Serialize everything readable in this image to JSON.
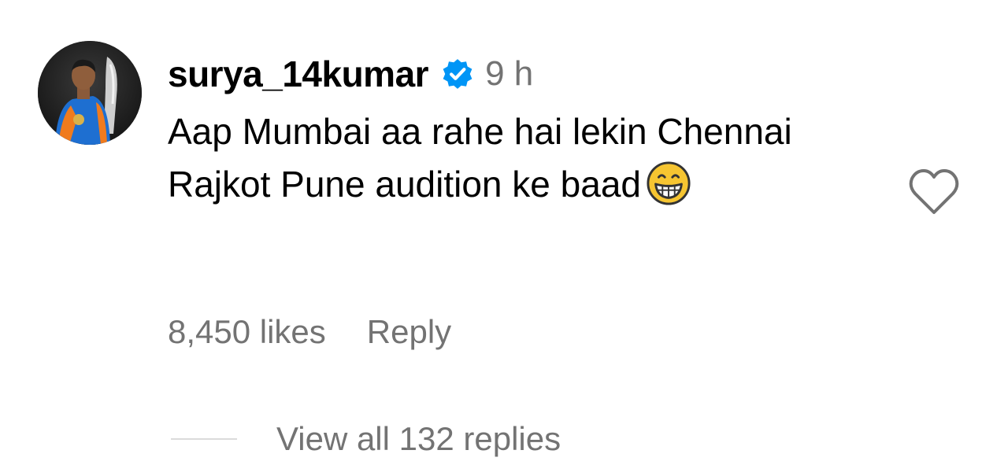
{
  "comment": {
    "username": "surya_14kumar",
    "verified_icon": "verified-badge-icon",
    "time": "9 h",
    "text": "Aap Mumbai aa rahe hai lekin Chennai Rajkot Pune audition ke baad",
    "emoji": "grinning-face-with-smiling-eyes",
    "likes": "8,450 likes",
    "reply_label": "Reply",
    "view_replies": "View all 132 replies",
    "heart_icon": "heart-outline-icon"
  },
  "colors": {
    "text_primary": "#000000",
    "text_secondary": "#737373",
    "verified_blue": "#0095f6",
    "divider": "#dbdbdb"
  }
}
